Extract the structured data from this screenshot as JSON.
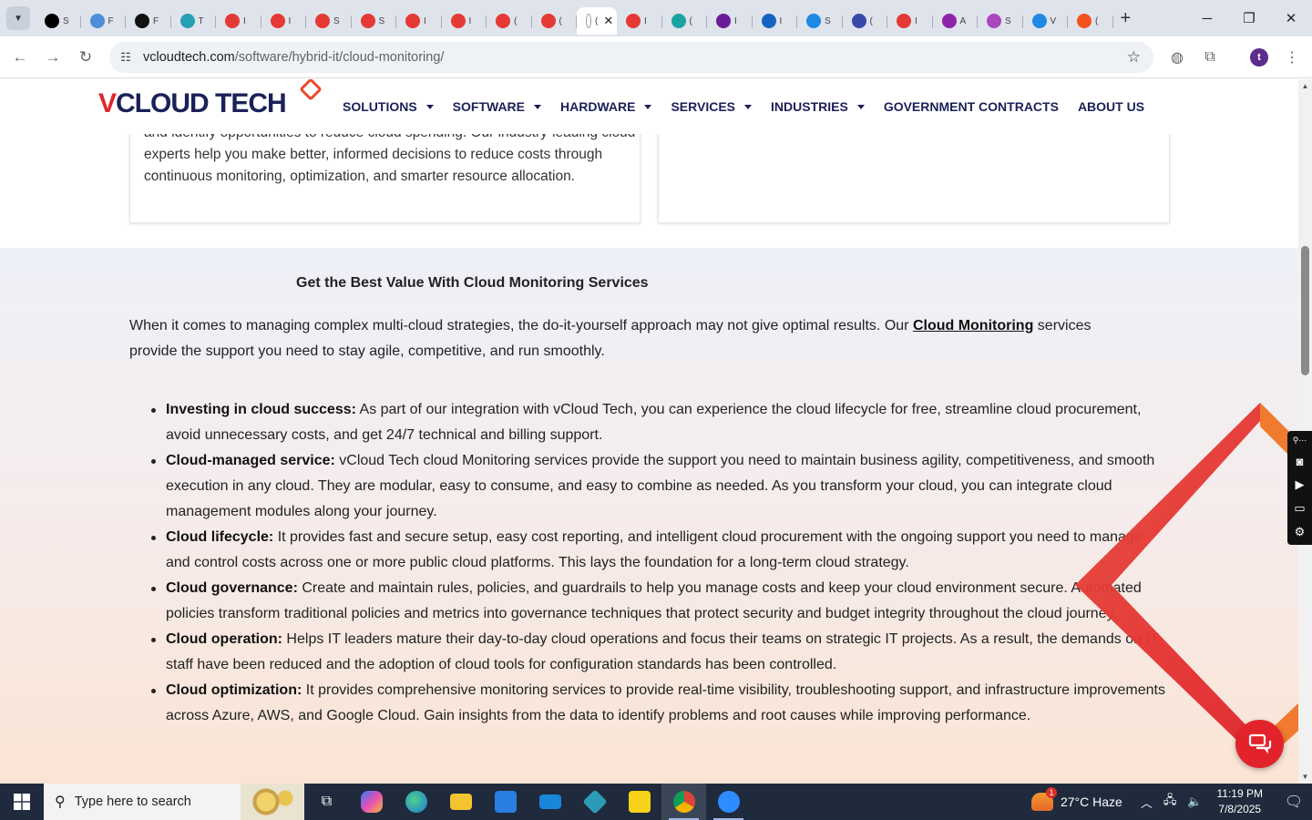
{
  "browser": {
    "tabs": [
      {
        "fav": "#000000",
        "lbl": "S"
      },
      {
        "fav": "#4a8fd8",
        "lbl": "F"
      },
      {
        "fav": "#111111",
        "lbl": "F"
      },
      {
        "fav": "#25a0b5",
        "lbl": "T"
      },
      {
        "fav": "#e53935",
        "lbl": "I"
      },
      {
        "fav": "#e53935",
        "lbl": "I"
      },
      {
        "fav": "#e53935",
        "lbl": "S"
      },
      {
        "fav": "#e53935",
        "lbl": "S"
      },
      {
        "fav": "#e53935",
        "lbl": "I"
      },
      {
        "fav": "#e53935",
        "lbl": "I"
      },
      {
        "fav": "#e53935",
        "lbl": "("
      },
      {
        "fav": "#e53935",
        "lbl": "("
      },
      {
        "fav": "#ffffff",
        "lbl": "(",
        "active": true
      },
      {
        "fav": "#e53935",
        "lbl": "I"
      },
      {
        "fav": "#1aa3a3",
        "lbl": "("
      },
      {
        "fav": "#6a1b9a",
        "lbl": "I"
      },
      {
        "fav": "#1565c0",
        "lbl": "I"
      },
      {
        "fav": "#1e88e5",
        "lbl": "S"
      },
      {
        "fav": "#3949ab",
        "lbl": "("
      },
      {
        "fav": "#e53935",
        "lbl": "I"
      },
      {
        "fav": "#8e24aa",
        "lbl": "A"
      },
      {
        "fav": "#ab47bc",
        "lbl": "S"
      },
      {
        "fav": "#1e88e5",
        "lbl": "V"
      },
      {
        "fav": "#f4511e",
        "lbl": "("
      }
    ],
    "url_host": "vcloudtech.com",
    "url_path": "/software/hybrid-it/cloud-monitoring/",
    "profile_initial": "t"
  },
  "site": {
    "logo_v": "V",
    "logo_rest": "CLOUD TECH",
    "nav": [
      {
        "label": "SOLUTIONS",
        "dropdown": true
      },
      {
        "label": "SOFTWARE",
        "dropdown": true
      },
      {
        "label": "HARDWARE",
        "dropdown": true
      },
      {
        "label": "SERVICES",
        "dropdown": true
      },
      {
        "label": "INDUSTRIES",
        "dropdown": true
      },
      {
        "label": "GOVERNMENT CONTRACTS",
        "dropdown": false
      },
      {
        "label": "ABOUT US",
        "dropdown": false
      }
    ],
    "card_text": "and identify opportunities to reduce cloud spending. Our industry-leading cloud experts help you make better, informed decisions to reduce costs through continuous monitoring, optimization, and smarter resource allocation.",
    "section_title": "Get the Best Value With Cloud Monitoring Services",
    "intro_before": "When it comes to managing complex multi-cloud strategies, the do-it-yourself approach may not give optimal results. Our ",
    "intro_link": "Cloud Monitoring",
    "intro_after": " services provide the support you need to stay agile, competitive, and run smoothly.",
    "bullets": [
      {
        "term": "Investing in cloud success:",
        "text": " As part of our integration with vCloud Tech, you can experience the cloud lifecycle for free, streamline cloud procurement, avoid unnecessary costs, and get 24/7 technical and billing support."
      },
      {
        "term": "Cloud-managed service:",
        "text": " vCloud Tech cloud Monitoring services provide the support you need to maintain business agility, competitiveness, and smooth execution in any cloud. They are modular, easy to consume, and easy to combine as needed. As you transform your cloud, you can integrate cloud management modules along your journey."
      },
      {
        "term": "Cloud lifecycle:",
        "text": " It provides fast and secure setup, easy cost reporting, and intelligent cloud procurement with the ongoing support you need to manage and control costs across one or more public cloud platforms. This lays the foundation for a long-term cloud strategy."
      },
      {
        "term": "Cloud governance:",
        "text": " Create and maintain rules, policies, and guardrails to help you manage costs and keep your cloud environment secure. Automated policies transform traditional policies and metrics into governance techniques that protect security and budget integrity throughout the cloud journey."
      },
      {
        "term": "Cloud operation:",
        "text": " Helps IT leaders mature their day-to-day cloud operations and focus their teams on strategic IT projects. As a result, the demands on IT staff have been reduced and the adoption of cloud tools for configuration standards has been controlled."
      },
      {
        "term": "Cloud optimization:",
        "text": " It provides comprehensive monitoring services to provide real-time visibility, troubleshooting support, and infrastructure improvements across Azure, AWS, and Google Cloud. Gain insights from the data to identify problems and root causes while improving performance."
      }
    ]
  },
  "taskbar": {
    "search_placeholder": "Type here to search",
    "weather_badge": "1",
    "weather": "27°C  Haze",
    "time": "11:19 PM",
    "date": "7/8/2025"
  },
  "colors": {
    "brand_navy": "#1b2158",
    "brand_red": "#e0262b",
    "accent_orange": "#e94c2c"
  }
}
